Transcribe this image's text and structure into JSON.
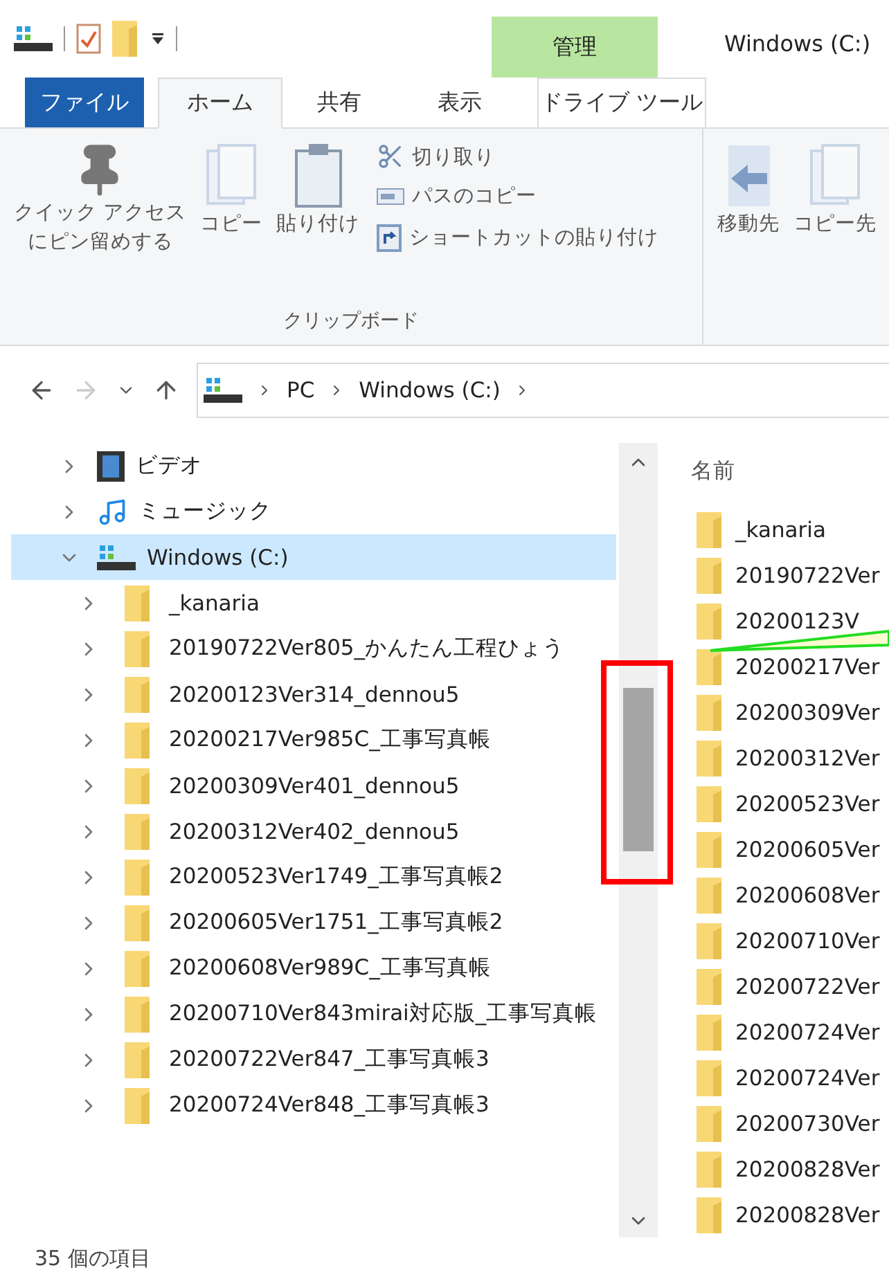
{
  "quick_access": {
    "context_tab": "管理",
    "title": "Windows (C:)"
  },
  "tabs": [
    {
      "label": "ファイル",
      "kind": "file",
      "selected": false
    },
    {
      "label": "ホーム",
      "kind": "tab",
      "selected": true
    },
    {
      "label": "共有",
      "kind": "tab",
      "selected": false
    },
    {
      "label": "表示",
      "kind": "tab",
      "selected": false
    },
    {
      "label": "ドライブ ツール",
      "kind": "context",
      "selected": false
    }
  ],
  "ribbon": {
    "clipboard": {
      "large": [
        {
          "lines": [
            "クイック アクセス",
            "にピン留めする"
          ],
          "kind": "pin"
        },
        {
          "label": "コピー",
          "kind": "copy"
        },
        {
          "label": "貼り付け",
          "kind": "paste"
        }
      ],
      "small": [
        {
          "label": "切り取り",
          "kind": "cut"
        },
        {
          "label": "パスのコピー",
          "kind": "path"
        },
        {
          "label": "ショートカットの貼り付け",
          "kind": "shortcut"
        }
      ],
      "group_label": "クリップボード"
    },
    "organize": [
      {
        "label": "移動先",
        "kind": "move"
      },
      {
        "label": "コピー先",
        "kind": "copyto"
      }
    ]
  },
  "address_bar": {
    "nav": [
      {
        "kind": "back",
        "disabled": false
      },
      {
        "kind": "forward",
        "disabled": true
      },
      {
        "kind": "recent",
        "disabled": false
      },
      {
        "kind": "up",
        "disabled": false
      }
    ],
    "path": [
      "PC",
      "Windows (C:)"
    ]
  },
  "nav_pane": {
    "items": [
      {
        "label": "ビデオ",
        "kind": "video",
        "expanded": false,
        "selected": false
      },
      {
        "label": "ミュージック",
        "kind": "music",
        "expanded": false,
        "selected": false
      },
      {
        "label": "Windows (C:)",
        "kind": "drive",
        "expanded": true,
        "selected": true,
        "children": [
          {
            "label": "_kanaria",
            "kind": "folder",
            "expanded": false,
            "selected": false
          },
          {
            "label": "20190722Ver805_かんたん工程ひょう",
            "kind": "folder",
            "expanded": false,
            "selected": false
          },
          {
            "label": "20200123Ver314_dennou5",
            "kind": "folder",
            "expanded": false,
            "selected": false
          },
          {
            "label": "20200217Ver985C_工事写真帳",
            "kind": "folder",
            "expanded": false,
            "selected": false
          },
          {
            "label": "20200309Ver401_dennou5",
            "kind": "folder",
            "expanded": false,
            "selected": false
          },
          {
            "label": "20200312Ver402_dennou5",
            "kind": "folder",
            "expanded": false,
            "selected": false
          },
          {
            "label": "20200523Ver1749_工事写真帳2",
            "kind": "folder",
            "expanded": false,
            "selected": false
          },
          {
            "label": "20200605Ver1751_工事写真帳2",
            "kind": "folder",
            "expanded": false,
            "selected": false
          },
          {
            "label": "20200608Ver989C_工事写真帳",
            "kind": "folder",
            "expanded": false,
            "selected": false
          },
          {
            "label": "20200710Ver843mirai対応版_工事写真帳",
            "kind": "folder",
            "expanded": false,
            "selected": false
          },
          {
            "label": "20200722Ver847_工事写真帳3",
            "kind": "folder",
            "expanded": false,
            "selected": false
          },
          {
            "label": "20200724Ver848_工事写真帳3",
            "kind": "folder",
            "expanded": false,
            "selected": false
          }
        ]
      }
    ]
  },
  "file_list": {
    "column": "名前",
    "rows": [
      "_kanaria",
      "20190722Ver",
      "20200123V",
      "20200217Ver",
      "20200309Ver",
      "20200312Ver",
      "20200523Ver",
      "20200605Ver",
      "20200608Ver",
      "20200710Ver",
      "20200722Ver",
      "20200724Ver",
      "20200724Ver",
      "20200730Ver",
      "20200828Ver",
      "20200828Ver"
    ]
  },
  "status_bar": "35 個の項目"
}
